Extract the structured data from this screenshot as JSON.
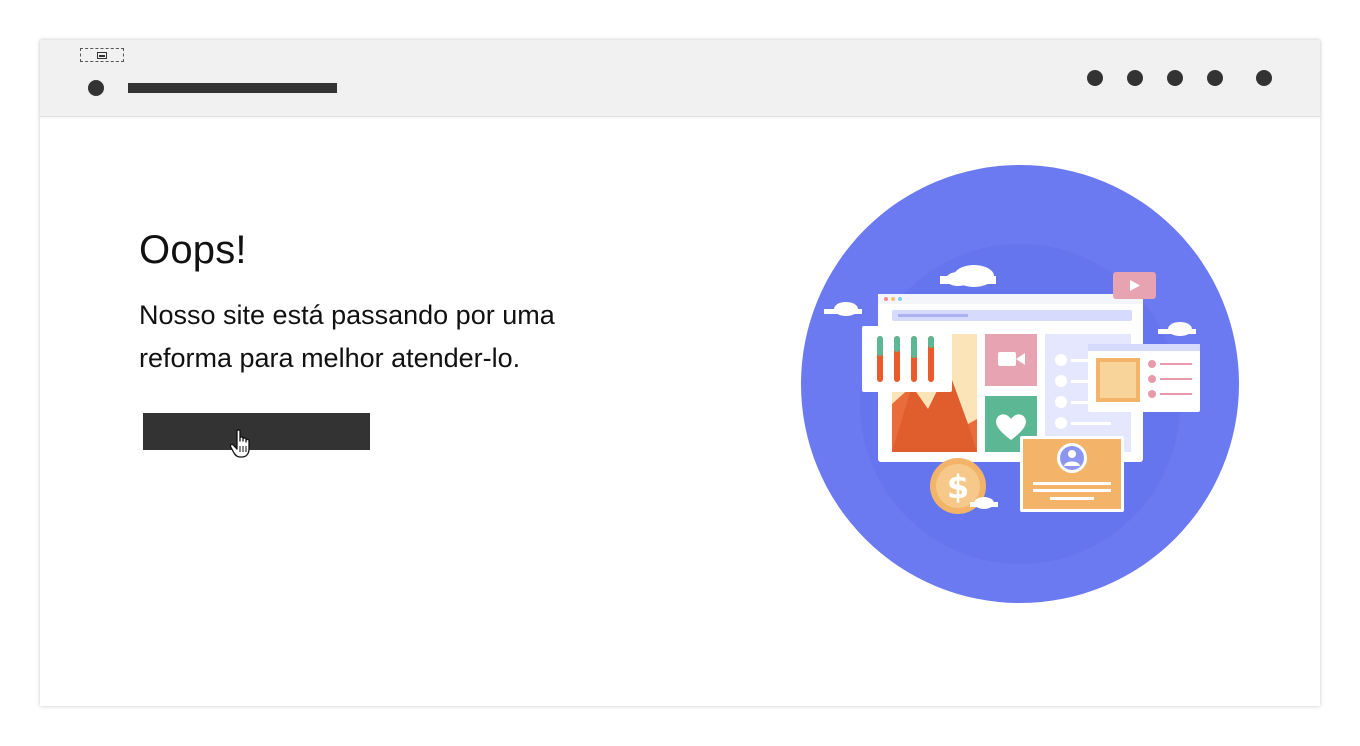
{
  "header": {
    "placeholder_icon": "image-placeholder-icon",
    "logo_icon": "logo-dot",
    "nav_items": [
      "nav-dot-1",
      "nav-dot-2",
      "nav-dot-3",
      "nav-dot-4",
      "nav-dot-5"
    ]
  },
  "main": {
    "title": "Oops!",
    "message_line1": "Nosso site está passando por uma",
    "message_line2": "reforma para melhor atender-lo.",
    "cta_label": "",
    "cursor_icon": "hand-pointer-icon"
  },
  "illustration": {
    "name": "maintenance-dashboard-illustration",
    "background_color": "#6b7af0"
  },
  "colors": {
    "topbar": "#f2f1f2",
    "dark": "#333333",
    "text": "#111111",
    "accent_circle": "#6b7af0"
  }
}
